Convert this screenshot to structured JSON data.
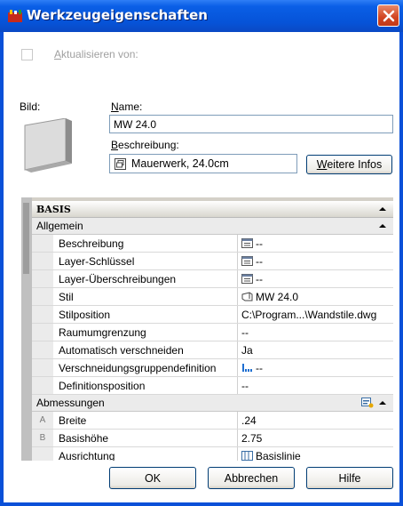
{
  "window": {
    "title": "Werkzeugeigenschaften"
  },
  "update": {
    "label_u": "A",
    "label_rest": "ktualisieren von:"
  },
  "image": {
    "label": "Bild:"
  },
  "name": {
    "label_u": "N",
    "label_rest": "ame:",
    "value": "MW 24.0"
  },
  "description": {
    "label_u": "B",
    "label_rest": "eschreibung:",
    "value": "Mauerwerk, 24.0cm",
    "more_button_u": "W",
    "more_button_rest": "eitere Infos"
  },
  "grid": {
    "category": "BASIS",
    "groups": [
      {
        "name": "Allgemein",
        "rows": [
          {
            "marker": "",
            "key": "Beschreibung",
            "value": "--",
            "icon": "list-icon"
          },
          {
            "marker": "",
            "key": "Layer-Schlüssel",
            "value": "--",
            "icon": "list-icon"
          },
          {
            "marker": "",
            "key": "Layer-Überschreibungen",
            "value": "--",
            "icon": "list-icon"
          },
          {
            "marker": "",
            "key": "Stil",
            "value": "MW 24.0",
            "icon": "style-icon"
          },
          {
            "marker": "",
            "key": "Stilposition",
            "value": "C:\\Program...\\Wandstile.dwg",
            "icon": ""
          },
          {
            "marker": "",
            "key": "Raumumgrenzung",
            "value": "--",
            "icon": ""
          },
          {
            "marker": "",
            "key": "Automatisch verschneiden",
            "value": "Ja",
            "icon": ""
          },
          {
            "marker": "",
            "key": "Verschneidungsgruppendefinition",
            "value": "--",
            "icon": "group-icon"
          },
          {
            "marker": "",
            "key": "Definitionsposition",
            "value": "--",
            "icon": ""
          }
        ]
      },
      {
        "name": "Abmessungen",
        "rows": [
          {
            "marker": "A",
            "key": "Breite",
            "value": ".24",
            "icon": ""
          },
          {
            "marker": "B",
            "key": "Basishöhe",
            "value": "2.75",
            "icon": ""
          },
          {
            "marker": "",
            "key": "Ausrichtung",
            "value": "Basislinie",
            "icon": "align-icon"
          }
        ]
      }
    ]
  },
  "buttons": {
    "ok": "OK",
    "cancel": "Abbrechen",
    "help": "Hilfe"
  }
}
